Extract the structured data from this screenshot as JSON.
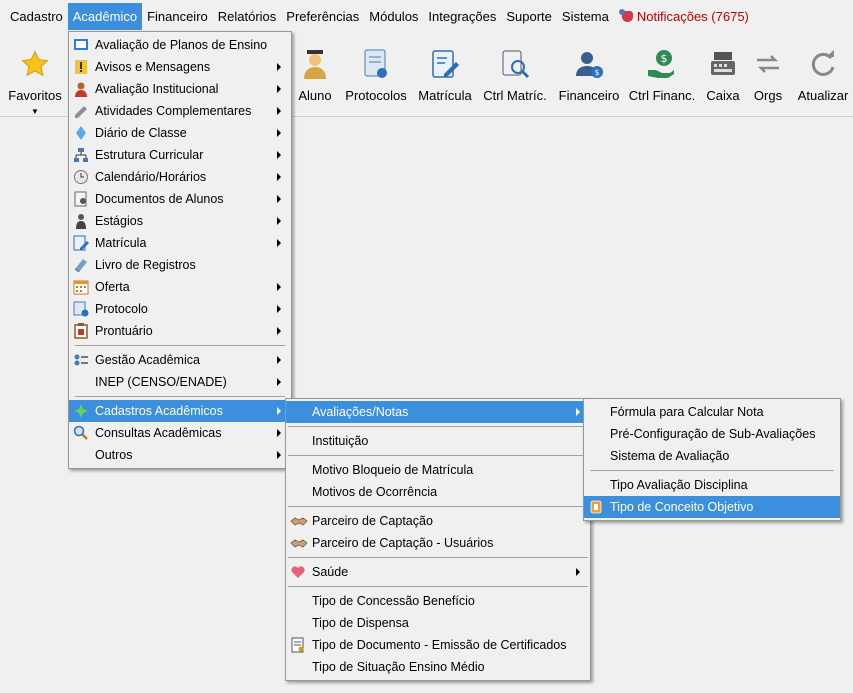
{
  "menubar": {
    "items": [
      "Cadastro",
      "Acadêmico",
      "Financeiro",
      "Relatórios",
      "Preferências",
      "Módulos",
      "Integrações",
      "Suporte",
      "Sistema"
    ],
    "notifications": "Notificações (7675)"
  },
  "toolbar": {
    "favoritos": "Favoritos",
    "aluno": "Aluno",
    "protocolos": "Protocolos",
    "matricula": "Matrícula",
    "ctrl_matric": "Ctrl Matríc.",
    "financeiro": "Financeiro",
    "ctrl_financ": "Ctrl Financ.",
    "caixa": "Caixa",
    "orgs": "Orgs",
    "atualizar": "Atualizar"
  },
  "menu_academico": {
    "items": [
      "Avaliação de Planos de Ensino",
      "Avisos e Mensagens",
      "Avaliação Institucional",
      "Atividades Complementares",
      "Diário de Classe",
      "Estrutura Curricular",
      "Calendário/Horários",
      "Documentos de Alunos",
      "Estágios",
      "Matrícula",
      "Livro de Registros",
      "Oferta",
      "Protocolo",
      "Prontuário",
      "Gestão Acadêmica",
      "INEP (CENSO/ENADE)",
      "Cadastros Acadêmicos",
      "Consultas Acadêmicas",
      "Outros"
    ]
  },
  "menu_cadastros": {
    "items": [
      "Avaliações/Notas",
      "Instituição",
      "Motivo Bloqueio de Matrícula",
      "Motivos de Ocorrência",
      "Parceiro de Captação",
      "Parceiro de Captação - Usuários",
      "Saúde",
      "Tipo de Concessão Benefício",
      "Tipo de Dispensa",
      "Tipo de Documento - Emissão de Certificados",
      "Tipo de Situação Ensino Médio"
    ]
  },
  "menu_avaliacoes": {
    "items": [
      "Fórmula para Calcular Nota",
      "Pré-Configuração de Sub-Avaliações",
      "Sistema de Avaliação",
      "Tipo Avaliação Disciplina",
      "Tipo de Conceito Objetivo"
    ]
  },
  "colors": {
    "highlight": "#3b8fdd",
    "notification": "#c00000"
  }
}
